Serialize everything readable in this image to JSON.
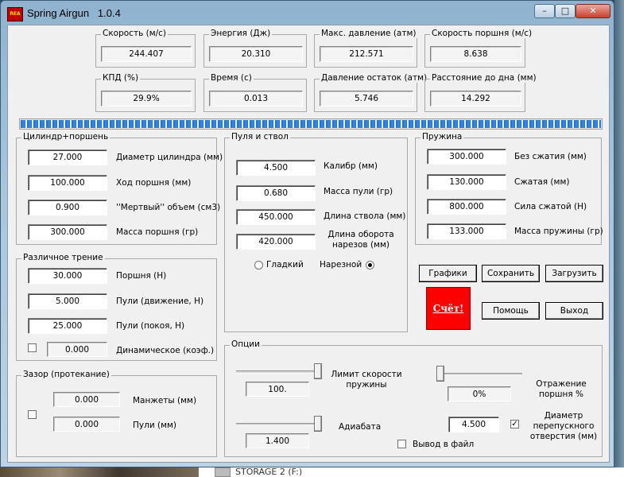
{
  "window": {
    "title": "Spring Airgun",
    "version": "1.0.4",
    "icon_text": "REA",
    "minimize": "–",
    "maximize": "□",
    "close": "✕"
  },
  "results": [
    {
      "label": "Скорость (м/с)",
      "value": "244.407"
    },
    {
      "label": "Энергия (Дж)",
      "value": "20.310"
    },
    {
      "label": "Макс. давление (атм)",
      "value": "212.571"
    },
    {
      "label": "Скорость поршня (м/с)",
      "value": "8.638"
    },
    {
      "label": "КПД (%)",
      "value": "29.9%"
    },
    {
      "label": "Время (с)",
      "value": "0.013"
    },
    {
      "label": "Давление остаток (атм)",
      "value": "5.746"
    },
    {
      "label": "Расстояние до дна (мм)",
      "value": "14.292"
    }
  ],
  "progress": {
    "fraction": 1.0,
    "color": "#1c6fd0"
  },
  "cylinder": {
    "title": "Цилиндр+поршень",
    "fields": [
      {
        "value": "27.000",
        "label": "Диаметр цилиндра (мм)"
      },
      {
        "value": "100.000",
        "label": "Ход поршня (мм)"
      },
      {
        "value": "0.900",
        "label": "''Мертвый'' объем (см3)"
      },
      {
        "value": "300.000",
        "label": "Масса поршня (гр)"
      }
    ]
  },
  "bullet": {
    "title": "Пуля и ствол",
    "fields": [
      {
        "value": "4.500",
        "label": "Калибр (мм)"
      },
      {
        "value": "0.680",
        "label": "Масса пули (гр)"
      },
      {
        "value": "450.000",
        "label": "Длина ствола (мм)"
      },
      {
        "value": "420.000",
        "label": "Длина оборота нарезов (мм)"
      }
    ],
    "radio_smooth": "Гладкий",
    "radio_rifled": "Нарезной",
    "selected": "rifled"
  },
  "spring": {
    "title": "Пружина",
    "fields": [
      {
        "value": "300.000",
        "label": "Без  сжатия (мм)"
      },
      {
        "value": "130.000",
        "label": "Сжатая (мм)"
      },
      {
        "value": "800.000",
        "label": "Сила сжатой (Н)"
      },
      {
        "value": "133.000",
        "label": "Масса пружины (гр)"
      }
    ]
  },
  "friction": {
    "title": "Различное трение",
    "fields": [
      {
        "value": "30.000",
        "label": "Поршня (Н)"
      },
      {
        "value": "5.000",
        "label": "Пули (движение, Н)"
      },
      {
        "value": "25.000",
        "label": "Пули (покоя, Н)"
      }
    ],
    "dynamic": {
      "checked": false,
      "value": "0.000",
      "label": "Динамическое (коэф.)"
    }
  },
  "gap": {
    "title": "Зазор (протекание)",
    "checked": false,
    "fields": [
      {
        "value": "0.000",
        "label": "Манжеты (мм)"
      },
      {
        "value": "0.000",
        "label": "Пули (мм)"
      }
    ]
  },
  "buttons": {
    "graphs": "Графики",
    "save": "Сохранить",
    "load": "Загрузить",
    "calc": "Счёт!",
    "help": "Помощь",
    "exit": "Выход"
  },
  "options": {
    "title": "Опции",
    "speed_limit": {
      "label": "Лимит скорости пружины",
      "value": "100.",
      "level": 1.0
    },
    "adiabat": {
      "label": "Адиабата",
      "value": "1.400",
      "level": 1.0
    },
    "reflection": {
      "label": "Отражение поршня %",
      "value": "0%",
      "level": 0.0
    },
    "bypass": {
      "value": "4.500",
      "checked": true,
      "label": "Диаметр перепускного отверстия (мм)"
    },
    "file_output": {
      "checked": false,
      "label": "Вывод в файл"
    }
  },
  "taskbar": {
    "storage_label": "STORAGE 2 (F:)"
  }
}
